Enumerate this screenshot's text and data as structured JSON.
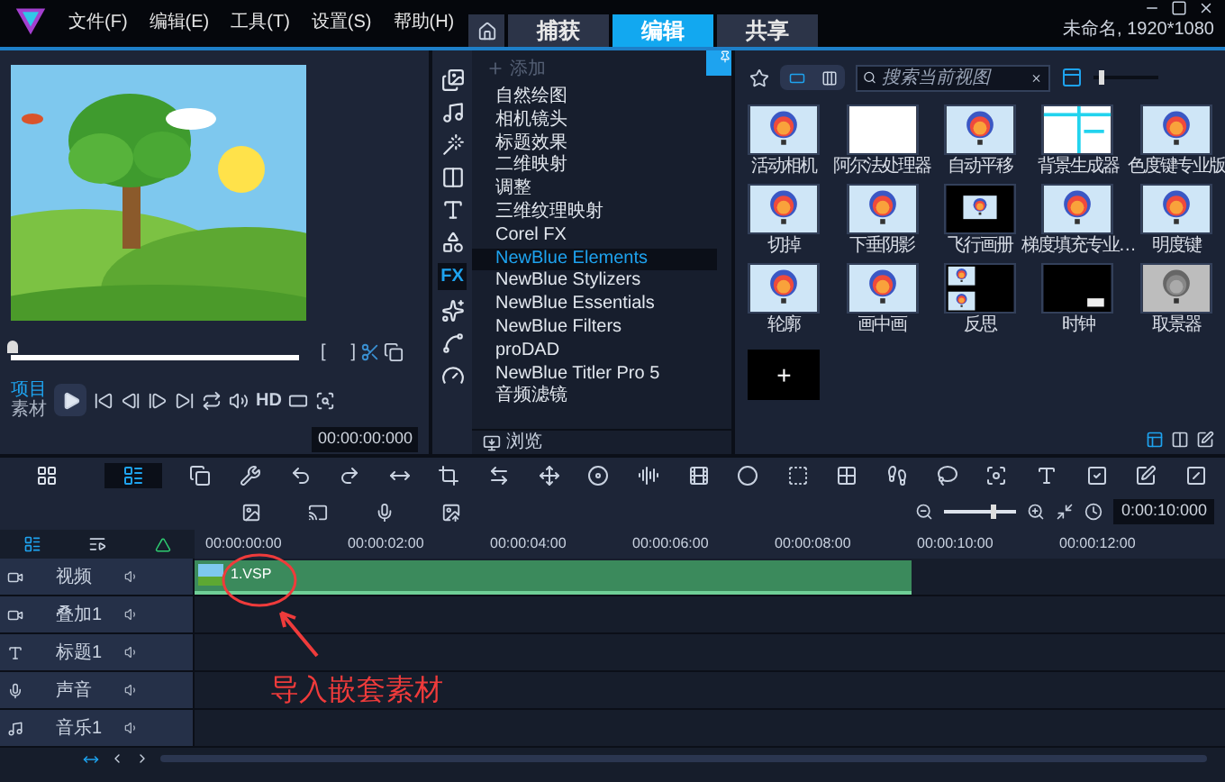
{
  "menu": [
    "文件(F)",
    "编辑(E)",
    "工具(T)",
    "设置(S)",
    "帮助(H)"
  ],
  "tabs": [
    {
      "label": "捕获",
      "selected": false
    },
    {
      "label": "编辑",
      "selected": true
    },
    {
      "label": "共享",
      "selected": false
    }
  ],
  "project": "未命名, 1920*1080",
  "player": {
    "trim_in": "[",
    "trim_out": "]",
    "modes": [
      {
        "label": "项目",
        "selected": true
      },
      {
        "label": "素材",
        "selected": false
      }
    ],
    "hd": "HD",
    "timecode": "00:00:00:000"
  },
  "library": {
    "nav": [
      {
        "kind": "media",
        "selected": false
      },
      {
        "kind": "audio",
        "selected": false
      },
      {
        "kind": "instant",
        "selected": false
      },
      {
        "kind": "transition",
        "selected": false
      },
      {
        "kind": "title",
        "selected": false
      },
      {
        "kind": "graphics",
        "selected": false
      },
      {
        "kind": "fx",
        "label": "FX",
        "selected": true
      },
      {
        "kind": "magic",
        "selected": false
      },
      {
        "kind": "path",
        "selected": false
      },
      {
        "kind": "speed",
        "selected": false
      }
    ],
    "add": "添加",
    "items": [
      {
        "label": "自然绘图",
        "selected": false
      },
      {
        "label": "相机镜头",
        "selected": false
      },
      {
        "label": "标题效果",
        "selected": false
      },
      {
        "label": "二维映射",
        "selected": false
      },
      {
        "label": "调整",
        "selected": false
      },
      {
        "label": "三维纹理映射",
        "selected": false
      },
      {
        "label": "Corel FX",
        "selected": false
      },
      {
        "label": "NewBlue Elements",
        "selected": true
      },
      {
        "label": "NewBlue Stylizers",
        "selected": false
      },
      {
        "label": "NewBlue Essentials",
        "selected": false
      },
      {
        "label": "NewBlue Filters",
        "selected": false
      },
      {
        "label": "proDAD",
        "selected": false
      },
      {
        "label": "NewBlue Titler Pro 5",
        "selected": false
      },
      {
        "label": "音频滤镜",
        "selected": false
      }
    ],
    "browse": "浏览"
  },
  "effects": {
    "view_modes": [
      {
        "kind": "single",
        "selected": true
      },
      {
        "kind": "split",
        "selected": false
      }
    ],
    "thumb_size": {
      "level": 0.1
    },
    "search_placeholder": "搜索当前视图",
    "items": [
      {
        "label": "活动相机",
        "kind": "balloon"
      },
      {
        "label": "阿尔法处理器",
        "kind": "white"
      },
      {
        "label": "自动平移",
        "kind": "balloon"
      },
      {
        "label": "背景生成器",
        "kind": "lines"
      },
      {
        "label": "色度键专业版",
        "kind": "balloon"
      },
      {
        "label": "切掉",
        "kind": "balloon"
      },
      {
        "label": "下垂阴影",
        "kind": "balloon"
      },
      {
        "label": "飞行画册",
        "kind": "framed"
      },
      {
        "label": "梯度填充专业…",
        "kind": "balloon"
      },
      {
        "label": "明度键",
        "kind": "balloon"
      },
      {
        "label": "轮廓",
        "kind": "balloon"
      },
      {
        "label": "画中画",
        "kind": "balloon"
      },
      {
        "label": "反思",
        "kind": "reflect"
      },
      {
        "label": "时钟",
        "kind": "clock"
      },
      {
        "label": "取景器",
        "kind": "gray"
      }
    ],
    "add_tile": "+"
  },
  "timeline": {
    "views": [
      {
        "kind": "storyboard",
        "selected": false
      },
      {
        "kind": "timeline",
        "selected": true
      }
    ],
    "duration": "0:00:10:000",
    "zoom": {
      "level": 0.7
    },
    "ruler": [
      "00:00:00:00",
      "00:00:02:00",
      "00:00:04:00",
      "00:00:06:00",
      "00:00:08:00",
      "00:00:10:00",
      "00:00:12:00"
    ],
    "tracks": [
      {
        "name": "视频",
        "kind": "video",
        "clip": "1.VSP"
      },
      {
        "name": "叠加1",
        "kind": "overlay"
      },
      {
        "name": "标题1",
        "kind": "title"
      },
      {
        "name": "声音",
        "kind": "voice"
      },
      {
        "name": "音乐1",
        "kind": "music"
      }
    ],
    "annotation": "导入嵌套素材"
  }
}
